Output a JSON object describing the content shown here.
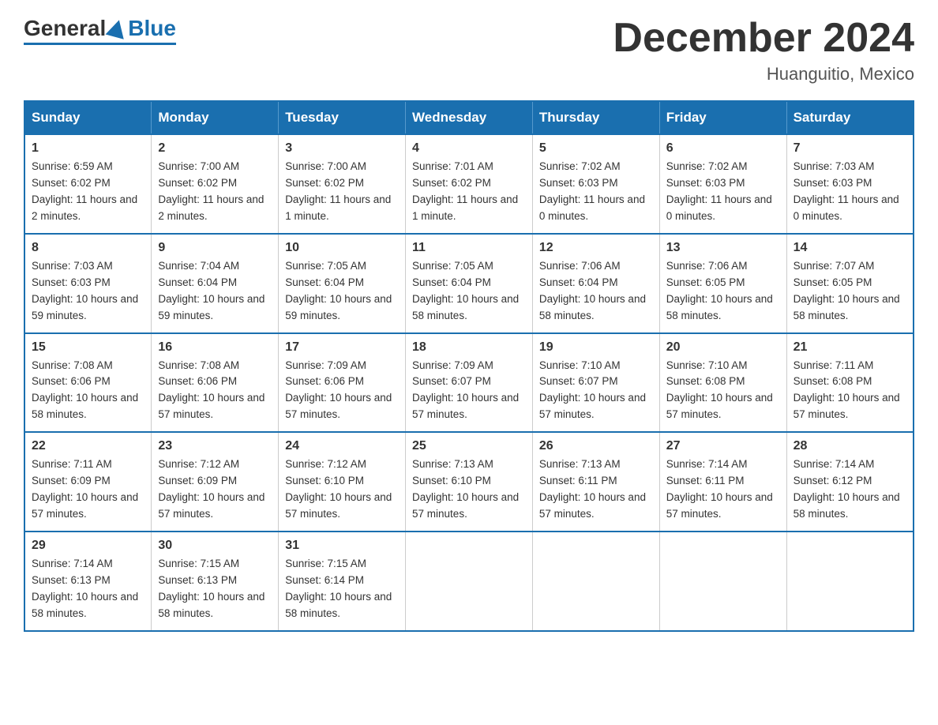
{
  "logo": {
    "general": "General",
    "blue": "Blue"
  },
  "header": {
    "month": "December 2024",
    "location": "Huanguitio, Mexico"
  },
  "days_of_week": [
    "Sunday",
    "Monday",
    "Tuesday",
    "Wednesday",
    "Thursday",
    "Friday",
    "Saturday"
  ],
  "weeks": [
    [
      {
        "day": "1",
        "sunrise": "6:59 AM",
        "sunset": "6:02 PM",
        "daylight": "11 hours and 2 minutes."
      },
      {
        "day": "2",
        "sunrise": "7:00 AM",
        "sunset": "6:02 PM",
        "daylight": "11 hours and 2 minutes."
      },
      {
        "day": "3",
        "sunrise": "7:00 AM",
        "sunset": "6:02 PM",
        "daylight": "11 hours and 1 minute."
      },
      {
        "day": "4",
        "sunrise": "7:01 AM",
        "sunset": "6:02 PM",
        "daylight": "11 hours and 1 minute."
      },
      {
        "day": "5",
        "sunrise": "7:02 AM",
        "sunset": "6:03 PM",
        "daylight": "11 hours and 0 minutes."
      },
      {
        "day": "6",
        "sunrise": "7:02 AM",
        "sunset": "6:03 PM",
        "daylight": "11 hours and 0 minutes."
      },
      {
        "day": "7",
        "sunrise": "7:03 AM",
        "sunset": "6:03 PM",
        "daylight": "11 hours and 0 minutes."
      }
    ],
    [
      {
        "day": "8",
        "sunrise": "7:03 AM",
        "sunset": "6:03 PM",
        "daylight": "10 hours and 59 minutes."
      },
      {
        "day": "9",
        "sunrise": "7:04 AM",
        "sunset": "6:04 PM",
        "daylight": "10 hours and 59 minutes."
      },
      {
        "day": "10",
        "sunrise": "7:05 AM",
        "sunset": "6:04 PM",
        "daylight": "10 hours and 59 minutes."
      },
      {
        "day": "11",
        "sunrise": "7:05 AM",
        "sunset": "6:04 PM",
        "daylight": "10 hours and 58 minutes."
      },
      {
        "day": "12",
        "sunrise": "7:06 AM",
        "sunset": "6:04 PM",
        "daylight": "10 hours and 58 minutes."
      },
      {
        "day": "13",
        "sunrise": "7:06 AM",
        "sunset": "6:05 PM",
        "daylight": "10 hours and 58 minutes."
      },
      {
        "day": "14",
        "sunrise": "7:07 AM",
        "sunset": "6:05 PM",
        "daylight": "10 hours and 58 minutes."
      }
    ],
    [
      {
        "day": "15",
        "sunrise": "7:08 AM",
        "sunset": "6:06 PM",
        "daylight": "10 hours and 58 minutes."
      },
      {
        "day": "16",
        "sunrise": "7:08 AM",
        "sunset": "6:06 PM",
        "daylight": "10 hours and 57 minutes."
      },
      {
        "day": "17",
        "sunrise": "7:09 AM",
        "sunset": "6:06 PM",
        "daylight": "10 hours and 57 minutes."
      },
      {
        "day": "18",
        "sunrise": "7:09 AM",
        "sunset": "6:07 PM",
        "daylight": "10 hours and 57 minutes."
      },
      {
        "day": "19",
        "sunrise": "7:10 AM",
        "sunset": "6:07 PM",
        "daylight": "10 hours and 57 minutes."
      },
      {
        "day": "20",
        "sunrise": "7:10 AM",
        "sunset": "6:08 PM",
        "daylight": "10 hours and 57 minutes."
      },
      {
        "day": "21",
        "sunrise": "7:11 AM",
        "sunset": "6:08 PM",
        "daylight": "10 hours and 57 minutes."
      }
    ],
    [
      {
        "day": "22",
        "sunrise": "7:11 AM",
        "sunset": "6:09 PM",
        "daylight": "10 hours and 57 minutes."
      },
      {
        "day": "23",
        "sunrise": "7:12 AM",
        "sunset": "6:09 PM",
        "daylight": "10 hours and 57 minutes."
      },
      {
        "day": "24",
        "sunrise": "7:12 AM",
        "sunset": "6:10 PM",
        "daylight": "10 hours and 57 minutes."
      },
      {
        "day": "25",
        "sunrise": "7:13 AM",
        "sunset": "6:10 PM",
        "daylight": "10 hours and 57 minutes."
      },
      {
        "day": "26",
        "sunrise": "7:13 AM",
        "sunset": "6:11 PM",
        "daylight": "10 hours and 57 minutes."
      },
      {
        "day": "27",
        "sunrise": "7:14 AM",
        "sunset": "6:11 PM",
        "daylight": "10 hours and 57 minutes."
      },
      {
        "day": "28",
        "sunrise": "7:14 AM",
        "sunset": "6:12 PM",
        "daylight": "10 hours and 58 minutes."
      }
    ],
    [
      {
        "day": "29",
        "sunrise": "7:14 AM",
        "sunset": "6:13 PM",
        "daylight": "10 hours and 58 minutes."
      },
      {
        "day": "30",
        "sunrise": "7:15 AM",
        "sunset": "6:13 PM",
        "daylight": "10 hours and 58 minutes."
      },
      {
        "day": "31",
        "sunrise": "7:15 AM",
        "sunset": "6:14 PM",
        "daylight": "10 hours and 58 minutes."
      },
      null,
      null,
      null,
      null
    ]
  ],
  "labels": {
    "sunrise": "Sunrise:",
    "sunset": "Sunset:",
    "daylight": "Daylight:"
  }
}
